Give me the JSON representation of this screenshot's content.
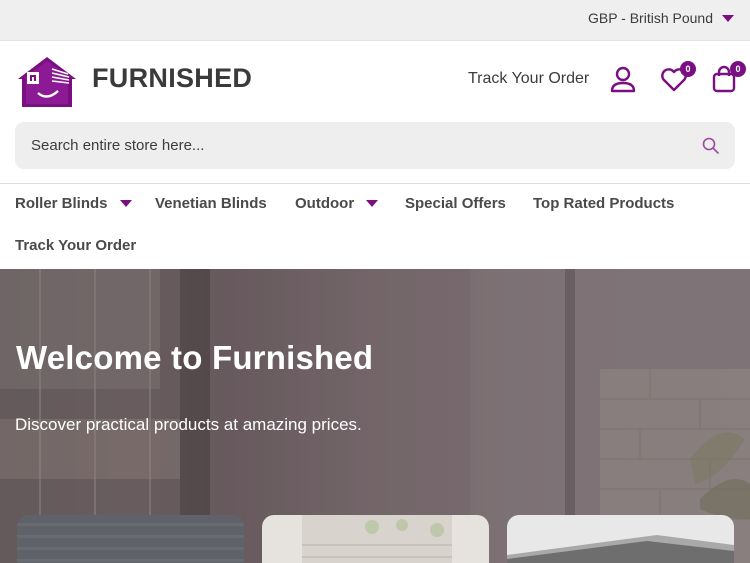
{
  "topbar": {
    "currency_label": "GBP - British Pound",
    "icons": {
      "dropdown": "caret-down-icon"
    }
  },
  "header": {
    "brand": "FURNISHED",
    "track_order_label": "Track Your Order",
    "wishlist_count": "0",
    "cart_count": "0",
    "icons": {
      "logo": "house-blinds-logo",
      "account": "user-icon",
      "wishlist": "heart-icon",
      "cart": "shopping-bag-icon"
    }
  },
  "search": {
    "placeholder": "Search entire store here...",
    "icon": "search-icon"
  },
  "nav": {
    "items": [
      {
        "label": "Roller Blinds",
        "has_dropdown": true
      },
      {
        "label": "Venetian Blinds",
        "has_dropdown": false
      },
      {
        "label": "Outdoor",
        "has_dropdown": true
      },
      {
        "label": "Special Offers",
        "has_dropdown": false
      },
      {
        "label": "Top Rated Products",
        "has_dropdown": false
      },
      {
        "label": "Track Your Order",
        "has_dropdown": false
      }
    ]
  },
  "hero": {
    "title": "Welcome to Furnished",
    "subtitle": "Discover practical products at amazing prices."
  },
  "colors": {
    "accent": "#7a0f82",
    "topbar_bg": "#efefef",
    "search_bg": "#eeeeee",
    "text": "#3a3a3a"
  }
}
